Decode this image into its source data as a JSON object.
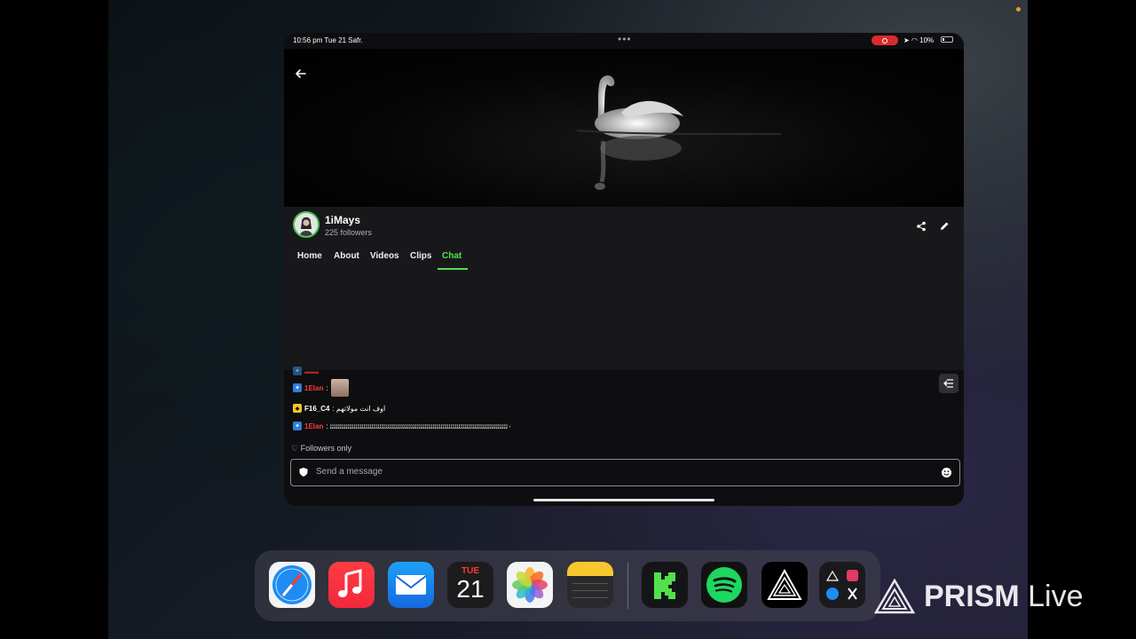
{
  "status_bar": {
    "time_date": "10:56 pm  Tue 21 Safr.",
    "battery": "10%"
  },
  "channel": {
    "name": "1iMays",
    "followers": "225 followers"
  },
  "tabs": [
    {
      "label": "Home"
    },
    {
      "label": "About"
    },
    {
      "label": "Videos"
    },
    {
      "label": "Clips"
    },
    {
      "label": "Chat"
    }
  ],
  "chat": {
    "messages": [
      {
        "user": "1Elan",
        "text": ":"
      },
      {
        "user": "F16_C4",
        "text": ": اوف انت مولاتهم"
      },
      {
        "user": "1Elan",
        "text": ": ٠ﺋﺋﺋﺋﺋﺋﺋﺋﺋﺋﺋﺋﺋﺋﺋﺋﺋﺋﺋﺋﺋﺋﺋﺋﺋﺋﺋﺋﺋﺋﺋﺋﺋﺋﺋﺋﺋﺋﺋﺋﺋﺋﺋﺋﺋﺋﺋﺋﺋﺋﺋﺋﺋﺋﺋﺋﺋﺋﺋﺋﺋﺋﺋﺋﺋﺋﺋﺋﺋﺋﺋﺋﺋﺋﺋﺋﺋﺋﺋﺋﺋﺋﺋﺋﺋﺋﺋﺋﺋﺋ"
      }
    ],
    "followers_only": "Followers only",
    "input_placeholder": "Send a message"
  },
  "dock": {
    "calendar_day": "TUE",
    "calendar_date": "21",
    "apps": [
      "Safari",
      "Music",
      "Mail",
      "Calendar",
      "Photos",
      "Notes",
      "Kick",
      "Spotify",
      "PRISM",
      "Folder"
    ]
  },
  "watermark": {
    "brand": "PRISM",
    "suffix": "Live"
  },
  "colors": {
    "accent": "#53e04d",
    "chat_user_red": "#ff3b3b",
    "background": "#0e0e10"
  }
}
